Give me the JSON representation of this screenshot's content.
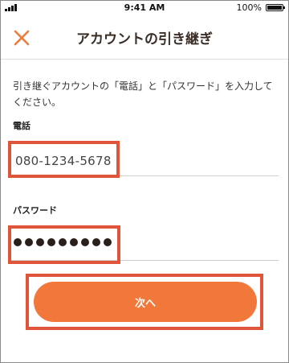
{
  "status_bar": {
    "time": "9:41 AM",
    "battery": "100%"
  },
  "nav": {
    "title": "アカウントの引き継ぎ",
    "close_icon": "close-icon"
  },
  "instructions": "引き継ぐアカウントの「電話」と「パスワード」を入力してください。",
  "phone": {
    "label": "電話",
    "value": "080-1234-5678"
  },
  "password": {
    "label": "パスワード",
    "value": "●●●●●●●●●"
  },
  "next_button": {
    "label": "次へ"
  },
  "colors": {
    "accent": "#f1773a",
    "highlight": "#e0553a",
    "close_icon": "#f07a3a"
  }
}
